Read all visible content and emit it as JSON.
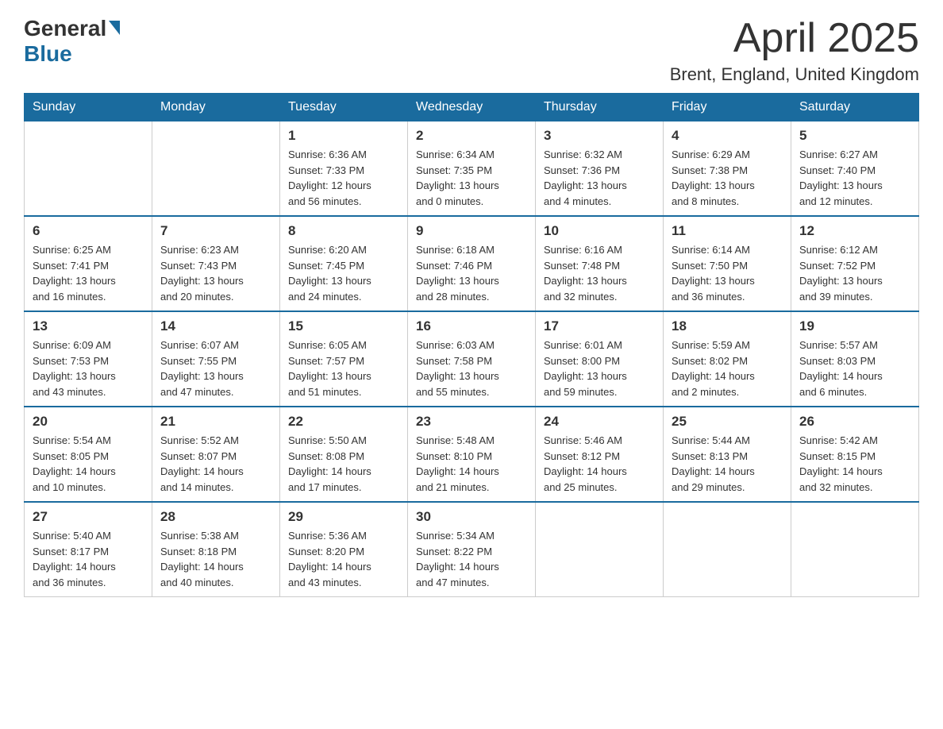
{
  "header": {
    "title": "April 2025",
    "subtitle": "Brent, England, United Kingdom",
    "logo_general": "General",
    "logo_blue": "Blue"
  },
  "days_of_week": [
    "Sunday",
    "Monday",
    "Tuesday",
    "Wednesday",
    "Thursday",
    "Friday",
    "Saturday"
  ],
  "weeks": [
    [
      {
        "day": "",
        "info": ""
      },
      {
        "day": "",
        "info": ""
      },
      {
        "day": "1",
        "info": "Sunrise: 6:36 AM\nSunset: 7:33 PM\nDaylight: 12 hours\nand 56 minutes."
      },
      {
        "day": "2",
        "info": "Sunrise: 6:34 AM\nSunset: 7:35 PM\nDaylight: 13 hours\nand 0 minutes."
      },
      {
        "day": "3",
        "info": "Sunrise: 6:32 AM\nSunset: 7:36 PM\nDaylight: 13 hours\nand 4 minutes."
      },
      {
        "day": "4",
        "info": "Sunrise: 6:29 AM\nSunset: 7:38 PM\nDaylight: 13 hours\nand 8 minutes."
      },
      {
        "day": "5",
        "info": "Sunrise: 6:27 AM\nSunset: 7:40 PM\nDaylight: 13 hours\nand 12 minutes."
      }
    ],
    [
      {
        "day": "6",
        "info": "Sunrise: 6:25 AM\nSunset: 7:41 PM\nDaylight: 13 hours\nand 16 minutes."
      },
      {
        "day": "7",
        "info": "Sunrise: 6:23 AM\nSunset: 7:43 PM\nDaylight: 13 hours\nand 20 minutes."
      },
      {
        "day": "8",
        "info": "Sunrise: 6:20 AM\nSunset: 7:45 PM\nDaylight: 13 hours\nand 24 minutes."
      },
      {
        "day": "9",
        "info": "Sunrise: 6:18 AM\nSunset: 7:46 PM\nDaylight: 13 hours\nand 28 minutes."
      },
      {
        "day": "10",
        "info": "Sunrise: 6:16 AM\nSunset: 7:48 PM\nDaylight: 13 hours\nand 32 minutes."
      },
      {
        "day": "11",
        "info": "Sunrise: 6:14 AM\nSunset: 7:50 PM\nDaylight: 13 hours\nand 36 minutes."
      },
      {
        "day": "12",
        "info": "Sunrise: 6:12 AM\nSunset: 7:52 PM\nDaylight: 13 hours\nand 39 minutes."
      }
    ],
    [
      {
        "day": "13",
        "info": "Sunrise: 6:09 AM\nSunset: 7:53 PM\nDaylight: 13 hours\nand 43 minutes."
      },
      {
        "day": "14",
        "info": "Sunrise: 6:07 AM\nSunset: 7:55 PM\nDaylight: 13 hours\nand 47 minutes."
      },
      {
        "day": "15",
        "info": "Sunrise: 6:05 AM\nSunset: 7:57 PM\nDaylight: 13 hours\nand 51 minutes."
      },
      {
        "day": "16",
        "info": "Sunrise: 6:03 AM\nSunset: 7:58 PM\nDaylight: 13 hours\nand 55 minutes."
      },
      {
        "day": "17",
        "info": "Sunrise: 6:01 AM\nSunset: 8:00 PM\nDaylight: 13 hours\nand 59 minutes."
      },
      {
        "day": "18",
        "info": "Sunrise: 5:59 AM\nSunset: 8:02 PM\nDaylight: 14 hours\nand 2 minutes."
      },
      {
        "day": "19",
        "info": "Sunrise: 5:57 AM\nSunset: 8:03 PM\nDaylight: 14 hours\nand 6 minutes."
      }
    ],
    [
      {
        "day": "20",
        "info": "Sunrise: 5:54 AM\nSunset: 8:05 PM\nDaylight: 14 hours\nand 10 minutes."
      },
      {
        "day": "21",
        "info": "Sunrise: 5:52 AM\nSunset: 8:07 PM\nDaylight: 14 hours\nand 14 minutes."
      },
      {
        "day": "22",
        "info": "Sunrise: 5:50 AM\nSunset: 8:08 PM\nDaylight: 14 hours\nand 17 minutes."
      },
      {
        "day": "23",
        "info": "Sunrise: 5:48 AM\nSunset: 8:10 PM\nDaylight: 14 hours\nand 21 minutes."
      },
      {
        "day": "24",
        "info": "Sunrise: 5:46 AM\nSunset: 8:12 PM\nDaylight: 14 hours\nand 25 minutes."
      },
      {
        "day": "25",
        "info": "Sunrise: 5:44 AM\nSunset: 8:13 PM\nDaylight: 14 hours\nand 29 minutes."
      },
      {
        "day": "26",
        "info": "Sunrise: 5:42 AM\nSunset: 8:15 PM\nDaylight: 14 hours\nand 32 minutes."
      }
    ],
    [
      {
        "day": "27",
        "info": "Sunrise: 5:40 AM\nSunset: 8:17 PM\nDaylight: 14 hours\nand 36 minutes."
      },
      {
        "day": "28",
        "info": "Sunrise: 5:38 AM\nSunset: 8:18 PM\nDaylight: 14 hours\nand 40 minutes."
      },
      {
        "day": "29",
        "info": "Sunrise: 5:36 AM\nSunset: 8:20 PM\nDaylight: 14 hours\nand 43 minutes."
      },
      {
        "day": "30",
        "info": "Sunrise: 5:34 AM\nSunset: 8:22 PM\nDaylight: 14 hours\nand 47 minutes."
      },
      {
        "day": "",
        "info": ""
      },
      {
        "day": "",
        "info": ""
      },
      {
        "day": "",
        "info": ""
      }
    ]
  ]
}
